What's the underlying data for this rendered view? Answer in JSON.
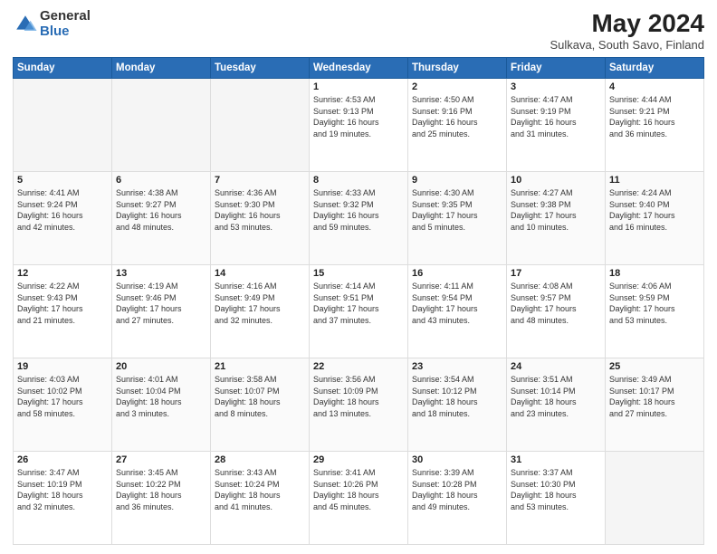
{
  "logo": {
    "general": "General",
    "blue": "Blue"
  },
  "title": "May 2024",
  "location": "Sulkava, South Savo, Finland",
  "days_header": [
    "Sunday",
    "Monday",
    "Tuesday",
    "Wednesday",
    "Thursday",
    "Friday",
    "Saturday"
  ],
  "weeks": [
    [
      {
        "day": "",
        "info": ""
      },
      {
        "day": "",
        "info": ""
      },
      {
        "day": "",
        "info": ""
      },
      {
        "day": "1",
        "info": "Sunrise: 4:53 AM\nSunset: 9:13 PM\nDaylight: 16 hours\nand 19 minutes."
      },
      {
        "day": "2",
        "info": "Sunrise: 4:50 AM\nSunset: 9:16 PM\nDaylight: 16 hours\nand 25 minutes."
      },
      {
        "day": "3",
        "info": "Sunrise: 4:47 AM\nSunset: 9:19 PM\nDaylight: 16 hours\nand 31 minutes."
      },
      {
        "day": "4",
        "info": "Sunrise: 4:44 AM\nSunset: 9:21 PM\nDaylight: 16 hours\nand 36 minutes."
      }
    ],
    [
      {
        "day": "5",
        "info": "Sunrise: 4:41 AM\nSunset: 9:24 PM\nDaylight: 16 hours\nand 42 minutes."
      },
      {
        "day": "6",
        "info": "Sunrise: 4:38 AM\nSunset: 9:27 PM\nDaylight: 16 hours\nand 48 minutes."
      },
      {
        "day": "7",
        "info": "Sunrise: 4:36 AM\nSunset: 9:30 PM\nDaylight: 16 hours\nand 53 minutes."
      },
      {
        "day": "8",
        "info": "Sunrise: 4:33 AM\nSunset: 9:32 PM\nDaylight: 16 hours\nand 59 minutes."
      },
      {
        "day": "9",
        "info": "Sunrise: 4:30 AM\nSunset: 9:35 PM\nDaylight: 17 hours\nand 5 minutes."
      },
      {
        "day": "10",
        "info": "Sunrise: 4:27 AM\nSunset: 9:38 PM\nDaylight: 17 hours\nand 10 minutes."
      },
      {
        "day": "11",
        "info": "Sunrise: 4:24 AM\nSunset: 9:40 PM\nDaylight: 17 hours\nand 16 minutes."
      }
    ],
    [
      {
        "day": "12",
        "info": "Sunrise: 4:22 AM\nSunset: 9:43 PM\nDaylight: 17 hours\nand 21 minutes."
      },
      {
        "day": "13",
        "info": "Sunrise: 4:19 AM\nSunset: 9:46 PM\nDaylight: 17 hours\nand 27 minutes."
      },
      {
        "day": "14",
        "info": "Sunrise: 4:16 AM\nSunset: 9:49 PM\nDaylight: 17 hours\nand 32 minutes."
      },
      {
        "day": "15",
        "info": "Sunrise: 4:14 AM\nSunset: 9:51 PM\nDaylight: 17 hours\nand 37 minutes."
      },
      {
        "day": "16",
        "info": "Sunrise: 4:11 AM\nSunset: 9:54 PM\nDaylight: 17 hours\nand 43 minutes."
      },
      {
        "day": "17",
        "info": "Sunrise: 4:08 AM\nSunset: 9:57 PM\nDaylight: 17 hours\nand 48 minutes."
      },
      {
        "day": "18",
        "info": "Sunrise: 4:06 AM\nSunset: 9:59 PM\nDaylight: 17 hours\nand 53 minutes."
      }
    ],
    [
      {
        "day": "19",
        "info": "Sunrise: 4:03 AM\nSunset: 10:02 PM\nDaylight: 17 hours\nand 58 minutes."
      },
      {
        "day": "20",
        "info": "Sunrise: 4:01 AM\nSunset: 10:04 PM\nDaylight: 18 hours\nand 3 minutes."
      },
      {
        "day": "21",
        "info": "Sunrise: 3:58 AM\nSunset: 10:07 PM\nDaylight: 18 hours\nand 8 minutes."
      },
      {
        "day": "22",
        "info": "Sunrise: 3:56 AM\nSunset: 10:09 PM\nDaylight: 18 hours\nand 13 minutes."
      },
      {
        "day": "23",
        "info": "Sunrise: 3:54 AM\nSunset: 10:12 PM\nDaylight: 18 hours\nand 18 minutes."
      },
      {
        "day": "24",
        "info": "Sunrise: 3:51 AM\nSunset: 10:14 PM\nDaylight: 18 hours\nand 23 minutes."
      },
      {
        "day": "25",
        "info": "Sunrise: 3:49 AM\nSunset: 10:17 PM\nDaylight: 18 hours\nand 27 minutes."
      }
    ],
    [
      {
        "day": "26",
        "info": "Sunrise: 3:47 AM\nSunset: 10:19 PM\nDaylight: 18 hours\nand 32 minutes."
      },
      {
        "day": "27",
        "info": "Sunrise: 3:45 AM\nSunset: 10:22 PM\nDaylight: 18 hours\nand 36 minutes."
      },
      {
        "day": "28",
        "info": "Sunrise: 3:43 AM\nSunset: 10:24 PM\nDaylight: 18 hours\nand 41 minutes."
      },
      {
        "day": "29",
        "info": "Sunrise: 3:41 AM\nSunset: 10:26 PM\nDaylight: 18 hours\nand 45 minutes."
      },
      {
        "day": "30",
        "info": "Sunrise: 3:39 AM\nSunset: 10:28 PM\nDaylight: 18 hours\nand 49 minutes."
      },
      {
        "day": "31",
        "info": "Sunrise: 3:37 AM\nSunset: 10:30 PM\nDaylight: 18 hours\nand 53 minutes."
      },
      {
        "day": "",
        "info": ""
      }
    ]
  ]
}
